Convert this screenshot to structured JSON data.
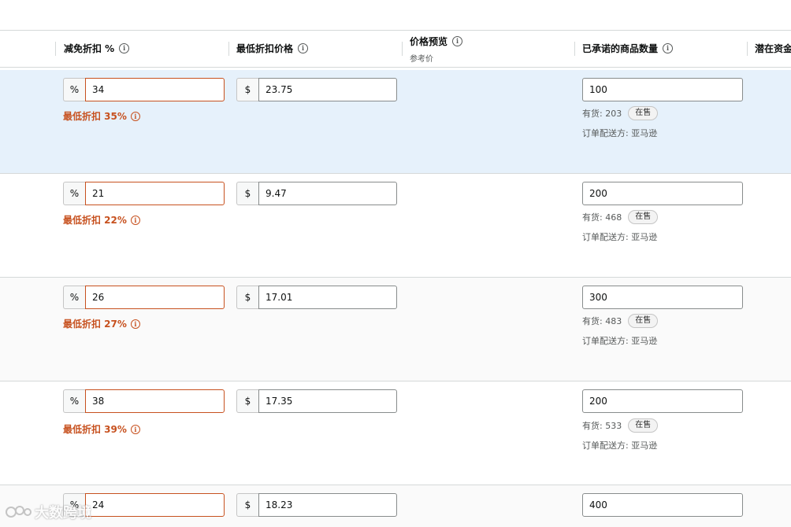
{
  "header": {
    "col_discount": "减免折扣 %",
    "col_min_price": "最低折扣价格",
    "col_preview": "价格预览",
    "col_preview_sub": "参考价",
    "col_qty": "已承诺的商品数量",
    "col_funds": "潜在资金"
  },
  "rows": [
    {
      "percent_prefix": "%",
      "discount": "34",
      "currency": "$",
      "price": "23.75",
      "error": "最低折扣 35%",
      "qty": "100",
      "stock": "有货: 203",
      "badge": "在售",
      "ship": "订单配送方: 亚马逊"
    },
    {
      "percent_prefix": "%",
      "discount": "21",
      "currency": "$",
      "price": "9.47",
      "error": "最低折扣 22%",
      "qty": "200",
      "stock": "有货: 468",
      "badge": "在售",
      "ship": "订单配送方: 亚马逊"
    },
    {
      "percent_prefix": "%",
      "discount": "26",
      "currency": "$",
      "price": "17.01",
      "error": "最低折扣 27%",
      "qty": "300",
      "stock": "有货: 483",
      "badge": "在售",
      "ship": "订单配送方: 亚马逊"
    },
    {
      "percent_prefix": "%",
      "discount": "38",
      "currency": "$",
      "price": "17.35",
      "error": "最低折扣 39%",
      "qty": "200",
      "stock": "有货: 533",
      "badge": "在售",
      "ship": "订单配送方: 亚马逊"
    },
    {
      "percent_prefix": "%",
      "discount": "24",
      "currency": "$",
      "price": "18.23",
      "qty": "400"
    }
  ],
  "icons": {
    "info": "info-icon",
    "error": "error-info-icon"
  },
  "colors": {
    "error": "#c7511f",
    "selected_row": "#e6f1fb",
    "border": "#d5d9d9"
  },
  "watermark": {
    "text": "大数跨境"
  }
}
